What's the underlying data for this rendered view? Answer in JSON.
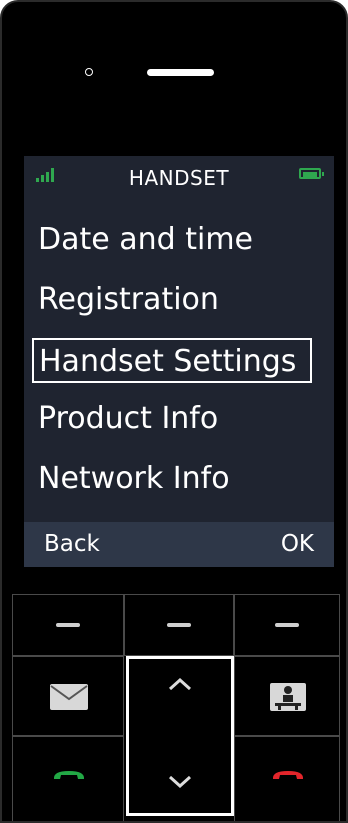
{
  "screen": {
    "title": "HANDSET",
    "menu": [
      {
        "label": "Date and time"
      },
      {
        "label": "Registration"
      },
      {
        "label": "Handset Settings",
        "selected": true
      },
      {
        "label": "Product Info"
      },
      {
        "label": "Network Info"
      }
    ],
    "softkeys": {
      "left": "Back",
      "right": "OK"
    }
  },
  "icons": {
    "signal": "signal-strength-icon",
    "battery": "battery-full-icon",
    "message": "envelope-icon",
    "contacts": "phonebook-icon",
    "call": "call-green-icon",
    "end": "end-call-red-icon"
  },
  "colors": {
    "screen_bg": "#1f2430",
    "softkey_bar": "#2e3748",
    "status_green": "#2fa84f",
    "call_green": "#22a845",
    "end_red": "#e2252b"
  }
}
